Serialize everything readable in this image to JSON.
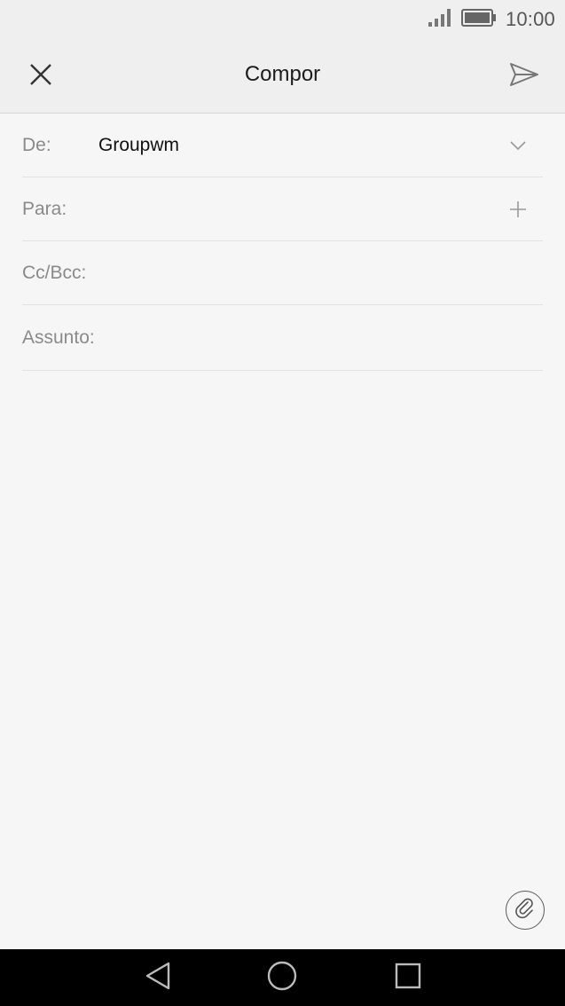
{
  "status_bar": {
    "time": "10:00",
    "signal_icon": "signal-icon",
    "battery_icon": "battery-icon"
  },
  "app_bar": {
    "title": "Compor",
    "close_icon": "close-icon",
    "send_icon": "send-icon"
  },
  "fields": {
    "from": {
      "label": "De:",
      "value": "Groupwm",
      "icon": "chevron-down-icon"
    },
    "to": {
      "label": "Para:",
      "value": "",
      "icon": "add-icon"
    },
    "cc_bcc": {
      "label": "Cc/Bcc:",
      "value": ""
    },
    "subject": {
      "label": "Assunto:",
      "value": ""
    }
  },
  "body": {
    "value": ""
  },
  "attach_icon": "paperclip-icon",
  "nav_bar": {
    "back_icon": "back-icon",
    "home_icon": "home-icon",
    "recents_icon": "recents-icon"
  },
  "colors": {
    "background": "#f6f6f6",
    "bar_background": "#efefef",
    "label_gray": "#8a8a8a",
    "text_dark": "#111111",
    "nav_bar": "#000000"
  }
}
